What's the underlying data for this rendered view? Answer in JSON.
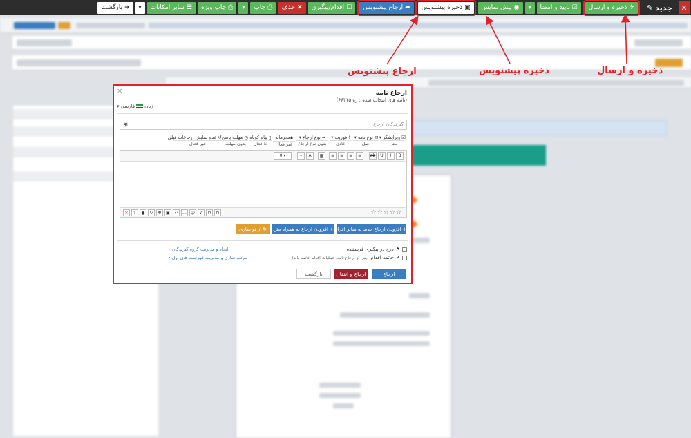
{
  "toolbar": {
    "new_label": "جدید",
    "send_save": "ذخیره و ارسال",
    "confirm_sign": "تایید و امضا",
    "preview": "پیش نمایش",
    "save_draft": "ذخیره پیشنویس",
    "refer_draft": "ارجاع پیشنویس",
    "action_followup": "اقدام/پیگیری",
    "delete": "حذف",
    "print": "چاپ",
    "special_print": "چاپ ویژه",
    "more_options": "سایر امکانات",
    "back": "بازگشت"
  },
  "annotations": {
    "send_save": "ذخیره و ارسال",
    "save_draft": "ذخیره پیشنویس",
    "refer_draft": "ارجاع پیشنویس"
  },
  "dialog": {
    "title": "ارجاع نامه",
    "subtitle": "(نامه های انتخاب شده : ره ۶۶۳۱۵)",
    "language": "فارسی",
    "language_label": "زبان",
    "receivers_placeholder": "گیرندگان ارجاع",
    "options": [
      {
        "label": "ویرایشگر",
        "value": "متن"
      },
      {
        "label": "نوع نامه",
        "value": "اصل"
      },
      {
        "label": "فوریت",
        "value": "عادی"
      },
      {
        "label": "نوع ارجاع",
        "value": "بدون نوع ارجاع"
      },
      {
        "label": "محرمانه",
        "value": "غیر فعال"
      },
      {
        "label": "پیام کوتاه",
        "value": "فعال"
      },
      {
        "label": "مهلت پاسخ",
        "value": "بدون مهلت"
      },
      {
        "label": "عدم نمایش ارجاعات قبلی",
        "value": "غیر فعال"
      }
    ],
    "add_refer_others": "افزودن ارجاع جدید به سایر افراد",
    "add_refer_text": "افزودن ارجاع به همراه متن",
    "reset": "از نو سازی",
    "chk_followup": "درج در پیگیری فرستنده",
    "chk_end_action": "خاتمه اقدام",
    "chk_end_action_note": "(پس از ارجاع نامه، عملیات اقدام خاتمه یابد)",
    "link_groups": "ایجاد و مدیریت گروه گیرندگان",
    "link_priority": "مرتب سازی و مدیریت فهرست های اول",
    "btn_refer": "ارجاع",
    "btn_refer_transfer": "ارجاع و انتقال",
    "btn_back": "بازگشت"
  },
  "colors": {
    "annotation_red": "#e0232b",
    "primary_blue": "#3a7dc1",
    "success_green": "#5cb85c",
    "danger_red": "#c9302c",
    "warning_orange": "#e0a030"
  }
}
